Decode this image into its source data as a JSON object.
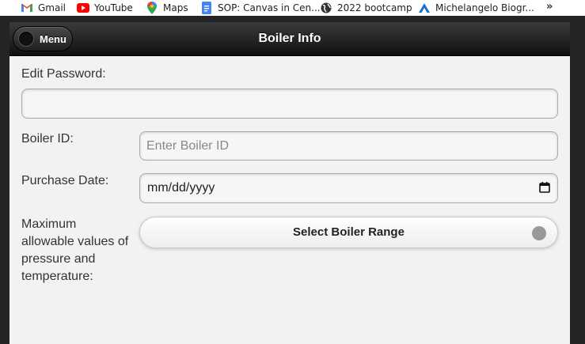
{
  "bookmarks": [
    {
      "label": "Gmail",
      "icon": "gmail-icon"
    },
    {
      "label": "YouTube",
      "icon": "youtube-icon"
    },
    {
      "label": "Maps",
      "icon": "maps-icon"
    },
    {
      "label": "SOP: Canvas in Cen...",
      "icon": "docs-icon"
    },
    {
      "label": "2022 bootcamp",
      "icon": "globe-icon"
    },
    {
      "label": "Michelangelo Biogr...",
      "icon": "bookmark-a-icon"
    }
  ],
  "bookmarks_more": "»",
  "header": {
    "menu_label": "Menu",
    "title": "Boiler Info"
  },
  "form": {
    "edit_password_label": "Edit Password:",
    "edit_password_value": "",
    "boiler_id_label": "Boiler ID:",
    "boiler_id_placeholder": "Enter Boiler ID",
    "purchase_date_label": "Purchase Date:",
    "purchase_date_value": "mm/dd/yyyy",
    "max_values_label_lines": [
      "Maximum",
      "allowable values of",
      "pressure and",
      "temperature:"
    ],
    "select_range_label": "Select Boiler Range"
  },
  "colors": {
    "header": "#1e1e1e",
    "page_bg": "#f2f2f2",
    "youtube_red": "#ff0000",
    "maps_green": "#34a853",
    "docs_blue": "#4285f4"
  }
}
